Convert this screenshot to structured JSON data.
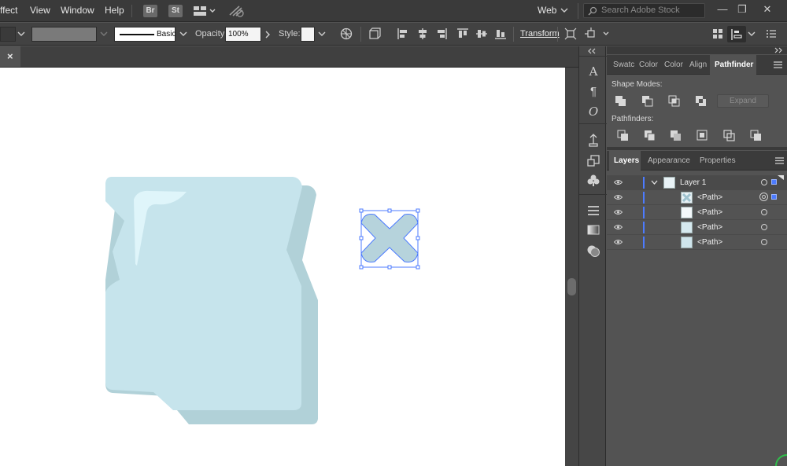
{
  "menu": {
    "items": [
      "ffect",
      "View",
      "Window",
      "Help"
    ],
    "bridge": "Br",
    "stock": "St",
    "workspace": "Web",
    "search_placeholder": "Search Adobe Stock"
  },
  "control": {
    "stroke_profile": "Basic",
    "opacity_label": "Opacity:",
    "opacity_value": "100%",
    "style_label": "Style:",
    "transform_label": "Transform"
  },
  "tab": {
    "close": "×"
  },
  "panels": {
    "top_tabs": [
      "Swatc",
      "Color",
      "Color",
      "Align",
      "Pathfinder"
    ],
    "shape_modes_label": "Shape Modes:",
    "expand_label": "Expand",
    "pathfinders_label": "Pathfinders:",
    "bottom_tabs": [
      "Layers",
      "Appearance",
      "Properties"
    ],
    "layers": [
      {
        "name": "Layer 1"
      },
      {
        "name": "<Path>"
      },
      {
        "name": "<Path>"
      },
      {
        "name": "<Path>"
      },
      {
        "name": "<Path>"
      }
    ]
  },
  "colors": {
    "chrome_dark": "#3a3a3a",
    "panel": "#535353",
    "selection_blue": "#4c7bff",
    "ice_light": "#c6e4ec",
    "ice_shadow": "#b1d1d8",
    "ice_highlight": "#dff5fa",
    "x_fill": "#b6d3dc"
  },
  "icons": {
    "panel_menu": "hamburger-icon",
    "collapse": "double-chevron-icon",
    "visibility": "eye-icon",
    "disclosure": "chevron-down-icon"
  }
}
